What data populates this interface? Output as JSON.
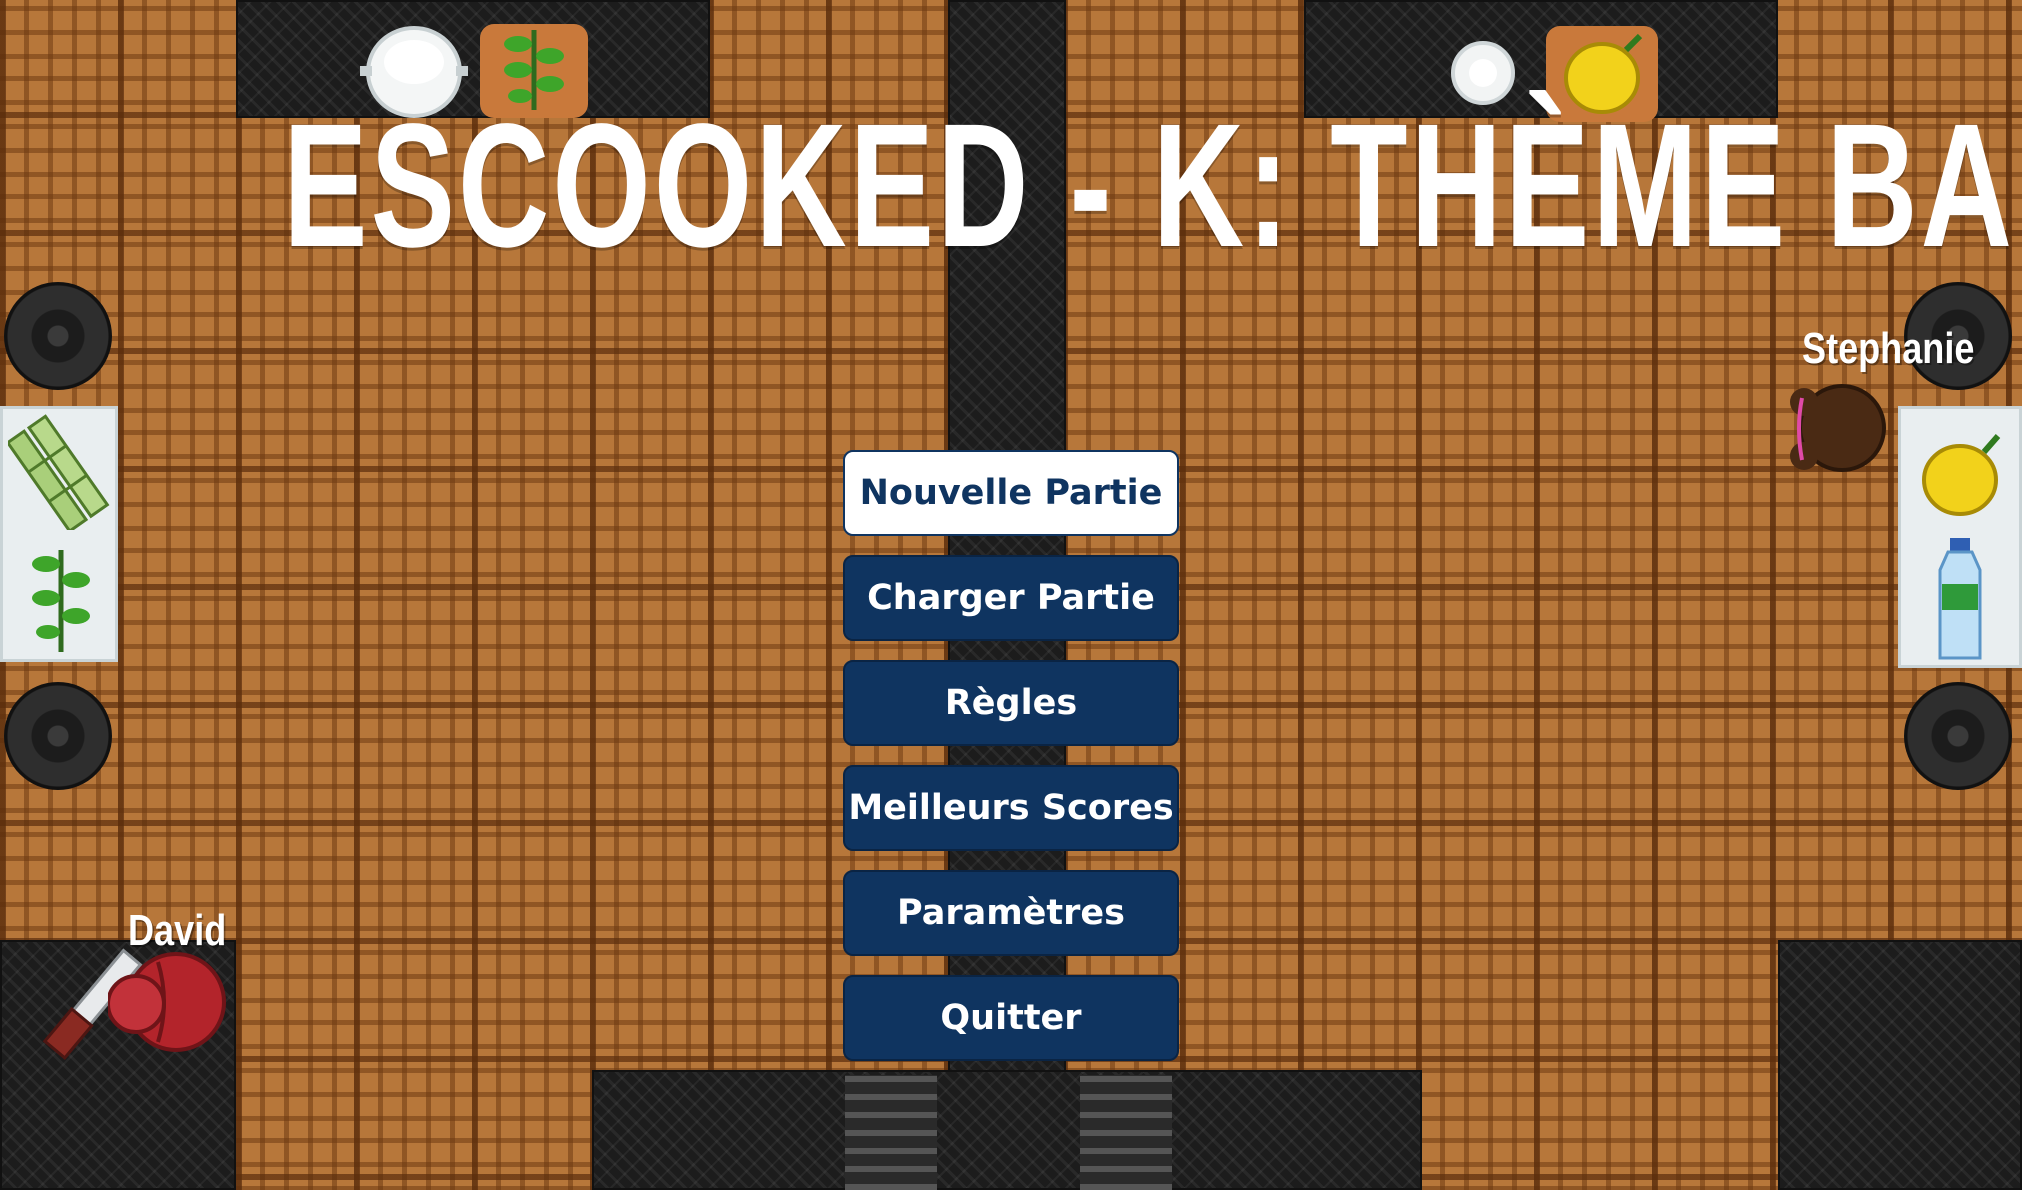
{
  "title": "ESCOOKED - K: THÈME BAR",
  "menu": {
    "items": [
      {
        "label": "Nouvelle Partie",
        "selected": true
      },
      {
        "label": "Charger Partie",
        "selected": false
      },
      {
        "label": "Règles",
        "selected": false
      },
      {
        "label": "Meilleurs Scores",
        "selected": false
      },
      {
        "label": "Paramètres",
        "selected": false
      },
      {
        "label": "Quitter",
        "selected": false
      }
    ]
  },
  "players": {
    "player1": {
      "name": "David",
      "color": "#b3242b"
    },
    "player2": {
      "name": "Stephanie",
      "color": "#4a2a14"
    }
  },
  "colors": {
    "button_bg": "#0f3460",
    "button_text": "#ffffff",
    "floor_wood": "#b7773a"
  },
  "ingredients": [
    "bowl-icon",
    "mint-icon",
    "plate-icon",
    "lemon-icon",
    "sugarcane-icon",
    "water-bottle-icon",
    "knife-icon"
  ]
}
